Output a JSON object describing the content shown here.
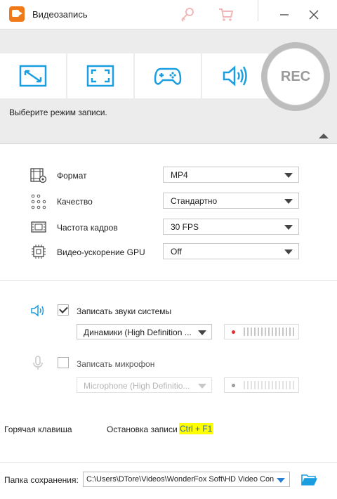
{
  "window": {
    "title": "Видеозапись"
  },
  "modes": {
    "hint": "Выберите режим записи.",
    "rec_label": "REC",
    "buttons": [
      {
        "icon": "region-capture-icon"
      },
      {
        "icon": "fullscreen-capture-icon"
      },
      {
        "icon": "gamepad-icon"
      },
      {
        "icon": "audio-only-icon"
      }
    ]
  },
  "settings": {
    "format": {
      "label": "Формат",
      "value": "MP4"
    },
    "quality": {
      "label": "Качество",
      "value": "Стандартно"
    },
    "framerate": {
      "label": "Частота кадров",
      "value": "30 FPS"
    },
    "gpu": {
      "label": "Видео-ускорение GPU",
      "value": "Off"
    }
  },
  "audio": {
    "system": {
      "label": "Записать звуки системы",
      "checked": true,
      "device": "Динамики (High Definition ..."
    },
    "mic": {
      "label": "Записать микрофон",
      "checked": false,
      "device": "Microphone (High Definitio..."
    }
  },
  "hotkey": {
    "label": "Горячая клавиша",
    "action": "Остановка записи",
    "keys": "Ctrl + F1"
  },
  "save": {
    "label": "Папка сохранения:",
    "path": "C:\\Users\\DTore\\Videos\\WonderFox Soft\\HD Video Conv"
  },
  "colors": {
    "accent": "#1a9ee0",
    "record_dot": "#e03030",
    "hotkey_highlight": "#ffff00",
    "brand": "#f07a1a"
  }
}
